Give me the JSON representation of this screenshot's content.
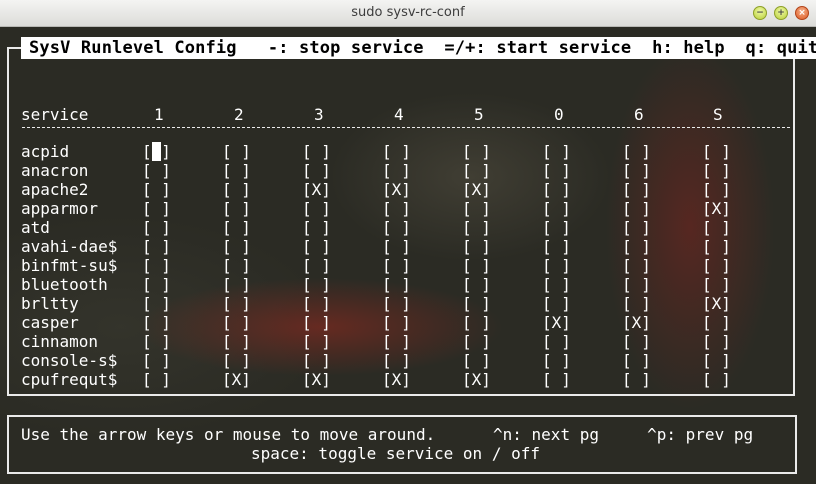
{
  "window": {
    "title": "sudo sysv-rc-conf"
  },
  "header": "SysV Runlevel Config   -: stop service  =/+: start service  h: help  q: quit",
  "columns": [
    "service",
    "1",
    "2",
    "3",
    "4",
    "5",
    "0",
    "6",
    "S"
  ],
  "rows": [
    {
      "name": "acpid",
      "states": [
        " ",
        " ",
        " ",
        " ",
        " ",
        " ",
        " ",
        " "
      ]
    },
    {
      "name": "anacron",
      "states": [
        " ",
        " ",
        " ",
        " ",
        " ",
        " ",
        " ",
        " "
      ]
    },
    {
      "name": "apache2",
      "states": [
        " ",
        " ",
        "X",
        "X",
        "X",
        " ",
        " ",
        " "
      ]
    },
    {
      "name": "apparmor",
      "states": [
        " ",
        " ",
        " ",
        " ",
        " ",
        " ",
        " ",
        "X"
      ]
    },
    {
      "name": "atd",
      "states": [
        " ",
        " ",
        " ",
        " ",
        " ",
        " ",
        " ",
        " "
      ]
    },
    {
      "name": "avahi-dae$",
      "states": [
        " ",
        " ",
        " ",
        " ",
        " ",
        " ",
        " ",
        " "
      ]
    },
    {
      "name": "binfmt-su$",
      "states": [
        " ",
        " ",
        " ",
        " ",
        " ",
        " ",
        " ",
        " "
      ]
    },
    {
      "name": "bluetooth",
      "states": [
        " ",
        " ",
        " ",
        " ",
        " ",
        " ",
        " ",
        " "
      ]
    },
    {
      "name": "brltty",
      "states": [
        " ",
        " ",
        " ",
        " ",
        " ",
        " ",
        " ",
        "X"
      ]
    },
    {
      "name": "casper",
      "states": [
        " ",
        " ",
        " ",
        " ",
        " ",
        "X",
        "X",
        " "
      ]
    },
    {
      "name": "cinnamon",
      "states": [
        " ",
        " ",
        " ",
        " ",
        " ",
        " ",
        " ",
        " "
      ]
    },
    {
      "name": "console-s$",
      "states": [
        " ",
        " ",
        " ",
        " ",
        " ",
        " ",
        " ",
        " "
      ]
    },
    {
      "name": "cpufrequt$",
      "states": [
        " ",
        "X",
        "X",
        "X",
        "X",
        " ",
        " ",
        " "
      ]
    }
  ],
  "footer": {
    "line1": "Use the arrow keys or mouse to move around.      ^n: next pg     ^p: prev pg",
    "line2": "space: toggle service on / off"
  }
}
